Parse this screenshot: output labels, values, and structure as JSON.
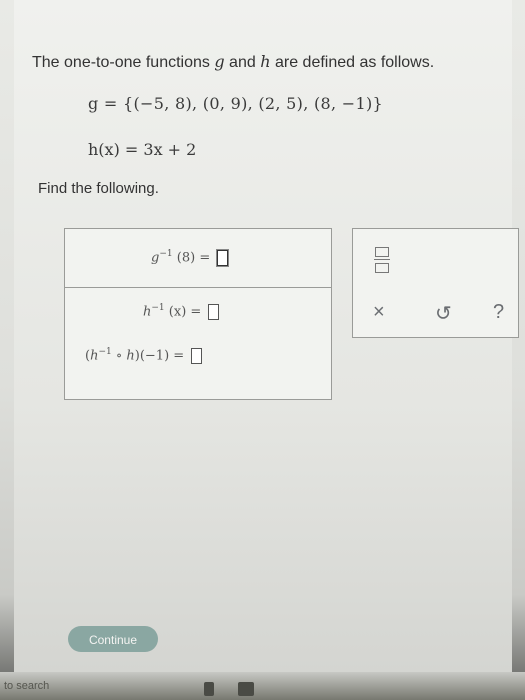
{
  "question": {
    "prompt_prefix": "The one-to-one functions",
    "g": "g",
    "and": "and",
    "h": "h",
    "prompt_suffix": "are defined as follows.",
    "g_definition": "g = {(−5, 8), (0, 9), (2, 5), (8, −1)}",
    "h_definition": "h(x) = 3x + 2",
    "find_label": "Find the following."
  },
  "answers": {
    "row1": {
      "func": "g",
      "sup": "−1",
      "arg": "(8)",
      "eq": "="
    },
    "row2": {
      "func": "h",
      "sup": "−1",
      "arg": "(x)",
      "eq": "="
    },
    "row3": {
      "open": "(",
      "func": "h",
      "sup": "−1",
      "compose": "∘",
      "func2": "h",
      "close": ")",
      "arg": "(−1)",
      "eq": "="
    }
  },
  "tools": {
    "clear": "×",
    "undo": "↺",
    "help": "?"
  },
  "continue_label": "Continue",
  "taskbar": {
    "search_text": "to search"
  },
  "colors": {
    "continue_bg": "#8aa7a2",
    "tool_icon": "#6b6e72"
  }
}
